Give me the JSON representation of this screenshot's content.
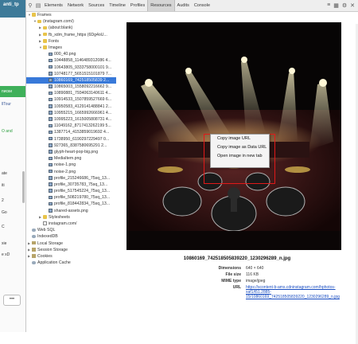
{
  "left_panel": {
    "header": "anti_tp",
    "green_label": "писки",
    "snippets": [
      "llTour",
      "O and",
      "ate",
      "iti",
      "2",
      "Go",
      "C",
      "xie",
      "e xD"
    ],
    "more_label": "•••"
  },
  "toolbar": {
    "tabs": [
      "Elements",
      "Network",
      "Sources",
      "Timeline",
      "Profiles",
      "Resources",
      "Audits",
      "Console"
    ],
    "active_tab": "Resources",
    "icons": [
      "search-icon",
      "console-icon"
    ],
    "right_icons": [
      "error-icon",
      "dock-icon",
      "gear-icon",
      "close-icon"
    ]
  },
  "tree": {
    "rows": [
      {
        "label": "Frames",
        "indent": 0,
        "icon": "folder",
        "open": true
      },
      {
        "label": "(instagram.com/)",
        "indent": 1,
        "icon": "folder",
        "open": true
      },
      {
        "label": "(about:blank)",
        "indent": 2,
        "icon": "folder",
        "open": false
      },
      {
        "label": "fb_xdm_frame_https (6Dg4oU...",
        "indent": 2,
        "icon": "folder",
        "open": false
      },
      {
        "label": "Fonts",
        "indent": 2,
        "icon": "folder",
        "open": false
      },
      {
        "label": "Images",
        "indent": 2,
        "icon": "folder",
        "open": true
      },
      {
        "label": "000_40.png",
        "indent": 3,
        "icon": "img"
      },
      {
        "label": "10448858_1146489312086 4...",
        "indent": 3,
        "icon": "img"
      },
      {
        "label": "10643805_9333758000101 9...",
        "indent": 3,
        "icon": "img"
      },
      {
        "label": "10748177_5651515101879 7...",
        "indent": 3,
        "icon": "img"
      },
      {
        "label": "10860169_742518505839 2...",
        "indent": 3,
        "icon": "img",
        "selected": true
      },
      {
        "label": "10865003_1558092216662 9...",
        "indent": 3,
        "icon": "img"
      },
      {
        "label": "10890881_7934063140611 4...",
        "indent": 3,
        "icon": "img"
      },
      {
        "label": "10914533_1507859527669 6...",
        "indent": 3,
        "icon": "img"
      },
      {
        "label": "10950583_4129141488841 2...",
        "indent": 3,
        "icon": "img"
      },
      {
        "label": "10955215_1665992666961 4...",
        "indent": 3,
        "icon": "img"
      },
      {
        "label": "10995223_1615005808731 4...",
        "indent": 3,
        "icon": "img"
      },
      {
        "label": "11049162_8717413262199 5...",
        "indent": 3,
        "icon": "img"
      },
      {
        "label": "1387714_4153859019692 4...",
        "indent": 3,
        "icon": "img"
      },
      {
        "label": "1738950_6190297229497 0...",
        "indent": 3,
        "icon": "img"
      },
      {
        "label": "927365_8387580695291 2...",
        "indent": 3,
        "icon": "img"
      },
      {
        "label": "glyph-heart-pop-big.png",
        "indent": 3,
        "icon": "img"
      },
      {
        "label": "MediaItem.png",
        "indent": 3,
        "icon": "img"
      },
      {
        "label": "noise-1.png",
        "indent": 3,
        "icon": "img"
      },
      {
        "label": "noise-2.png",
        "indent": 3,
        "icon": "img"
      },
      {
        "label": "profile_215246686_75sq_13...",
        "indent": 3,
        "icon": "img"
      },
      {
        "label": "profile_30735783_75sq_13...",
        "indent": 3,
        "icon": "img"
      },
      {
        "label": "profile_517545224_75sq_13...",
        "indent": 3,
        "icon": "img"
      },
      {
        "label": "profile_508219780_75sq_13...",
        "indent": 3,
        "icon": "img"
      },
      {
        "label": "profile_818442834_75sq_13...",
        "indent": 3,
        "icon": "img"
      },
      {
        "label": "shared-assets.png",
        "indent": 3,
        "icon": "img"
      },
      {
        "label": "Stylesheets",
        "indent": 2,
        "icon": "folder",
        "open": false
      },
      {
        "label": "instagram.com/",
        "indent": 2,
        "icon": "doc"
      },
      {
        "label": "Web SQL",
        "indent": 0,
        "icon": "db"
      },
      {
        "label": "IndexedDB",
        "indent": 0,
        "icon": "db"
      },
      {
        "label": "Local Storage",
        "indent": 0,
        "icon": "store",
        "open": false
      },
      {
        "label": "Session Storage",
        "indent": 0,
        "icon": "store",
        "open": false
      },
      {
        "label": "Cookies",
        "indent": 0,
        "icon": "store",
        "open": false
      },
      {
        "label": "Application Cache",
        "indent": 0,
        "icon": "db"
      }
    ]
  },
  "preview": {
    "filename": "10860169_742518505839220_1230296289_n.jpg",
    "meta": [
      {
        "key": "Dimensions",
        "value": "640 × 640"
      },
      {
        "key": "File size",
        "value": "116 KB"
      },
      {
        "key": "MIME type",
        "value": "image/jpeg"
      },
      {
        "key": "URL",
        "value": "https://scontent-b-ams.cdninstagram.com/hphotos-xaf1/t51.2885-15/10860169_742518505839220_1230296289_n.jpg",
        "link": true
      }
    ]
  },
  "context_menu": {
    "items": [
      "Copy image URL",
      "Copy image as Data URL",
      "Open image in new tab"
    ]
  },
  "colors": {
    "selection": "#3879d9",
    "highlight_box": "#e01919",
    "toolbar_bg": "#eeeeee"
  }
}
